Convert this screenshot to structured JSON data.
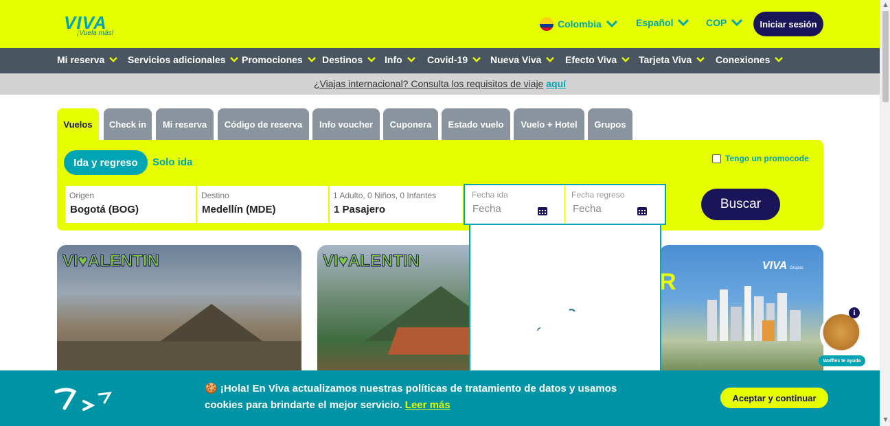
{
  "header": {
    "logo_text": "VIVA",
    "logo_tagline": "¡Vuela más!",
    "country": "Colombia",
    "language": "Español",
    "currency": "COP",
    "login_label": "Iniciar sesión"
  },
  "mainnav": {
    "items": [
      {
        "label": "Mi reserva"
      },
      {
        "label": "Servicios adicionales"
      },
      {
        "label": "Promociones"
      },
      {
        "label": "Destinos"
      },
      {
        "label": "Info"
      },
      {
        "label": "Covid-19"
      },
      {
        "label": "Nueva Viva"
      },
      {
        "label": "Efecto Viva"
      },
      {
        "label": "Tarjeta Viva"
      },
      {
        "label": "Conexiones"
      }
    ]
  },
  "notice": {
    "text": "¿Viajas internacional? Consulta los requisitos de viaje",
    "link": "aquí"
  },
  "search": {
    "tabs": [
      {
        "label": "Vuelos"
      },
      {
        "label": "Check in"
      },
      {
        "label": "Mi reserva"
      },
      {
        "label": "Código de reserva"
      },
      {
        "label": "Info voucher"
      },
      {
        "label": "Cuponera"
      },
      {
        "label": "Estado vuelo"
      },
      {
        "label": "Vuelo + Hotel"
      },
      {
        "label": "Grupos"
      }
    ],
    "trip_round": "Ida y regreso",
    "trip_oneway": "Solo ida",
    "promocode_label": "Tengo un promocode",
    "origin": {
      "label": "Origen",
      "value": "Bogotá (BOG)"
    },
    "destination": {
      "label": "Destino",
      "value": "Medellín (MDE)"
    },
    "passengers": {
      "label": "1 Adulto, 0 Niños, 0 Infantes",
      "value": "1 Pasajero"
    },
    "date_out": {
      "label": "Fecha ida",
      "placeholder": "Fecha"
    },
    "date_return": {
      "label": "Fecha regreso",
      "placeholder": "Fecha"
    },
    "search_button": "Buscar"
  },
  "cards": {
    "card1_badge": "VI♥ALENTIN",
    "card2_badge": "VI♥ALENTIN",
    "card3_brand": "VIVA",
    "card3_brand_sub": "Grupos"
  },
  "chat": {
    "label": "Waffles te ayuda",
    "info_icon": "i"
  },
  "cookie": {
    "text": "🍪 ¡Hola! En Viva actualizamos nuestras políticas de tratamiento de datos y usamos cookies para brindarte el mejor servicio.",
    "link": "Leer más",
    "accept": "Aceptar y continuar"
  },
  "colors": {
    "brand_yellow": "#e5ff00",
    "brand_teal": "#00a5b4",
    "brand_navy": "#1a1458",
    "nav_gray": "#4a5562"
  }
}
